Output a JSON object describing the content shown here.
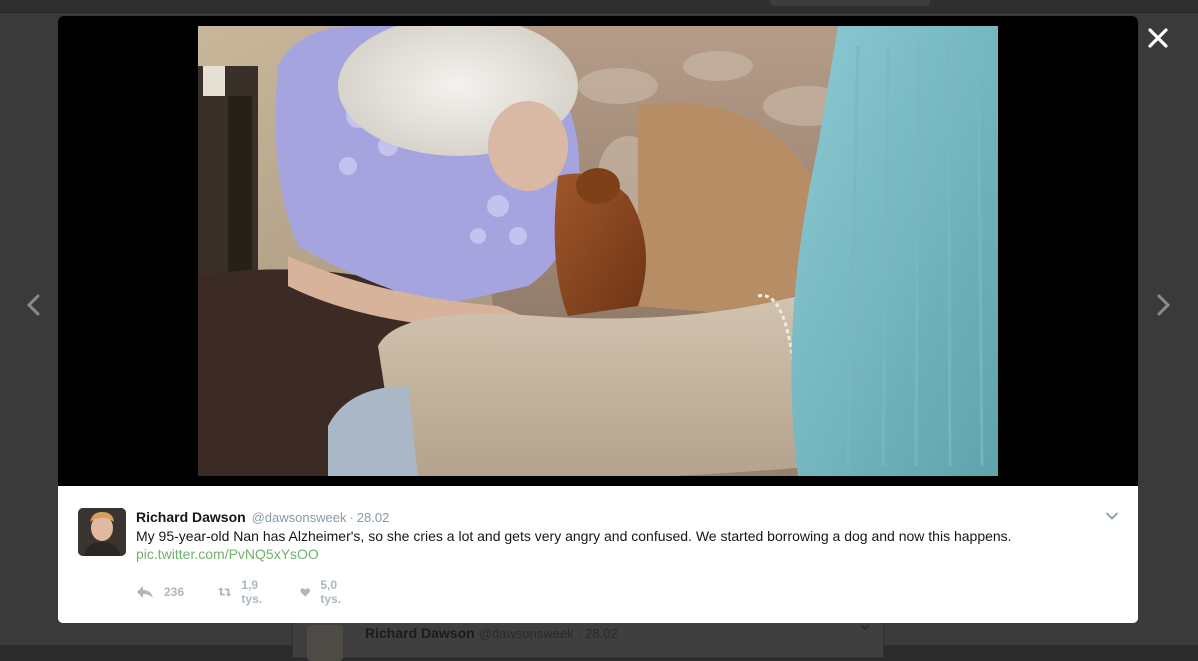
{
  "tweet": {
    "author_name": "Richard Dawson",
    "author_handle": "@dawsonsweek",
    "separator": "·",
    "timestamp": "28.02",
    "text": "My 95-year-old Nan has Alzheimer's, so she cries a lot and gets very angry and confused. We started borrowing a dog and now this happens.",
    "media_link": "pic.twitter.com/PvNQ5xYsOO",
    "actions": {
      "reply_count": "236",
      "retweet_count": "1,9 tys.",
      "like_count": "5,0 tys."
    }
  },
  "background_tweet": {
    "author_name": "Richard Dawson",
    "author_handle": "@dawsonsweek · 28.02"
  },
  "icons": {
    "close": "close-icon",
    "prev": "chevron-left-icon",
    "next": "chevron-right-icon",
    "caret": "chevron-down-icon",
    "reply": "reply-icon",
    "retweet": "retweet-icon",
    "like": "heart-icon"
  },
  "colors": {
    "link": "#6fb26a",
    "meta": "#8899a6",
    "action": "#aab8c2",
    "overlay": "#3a3a3a"
  }
}
